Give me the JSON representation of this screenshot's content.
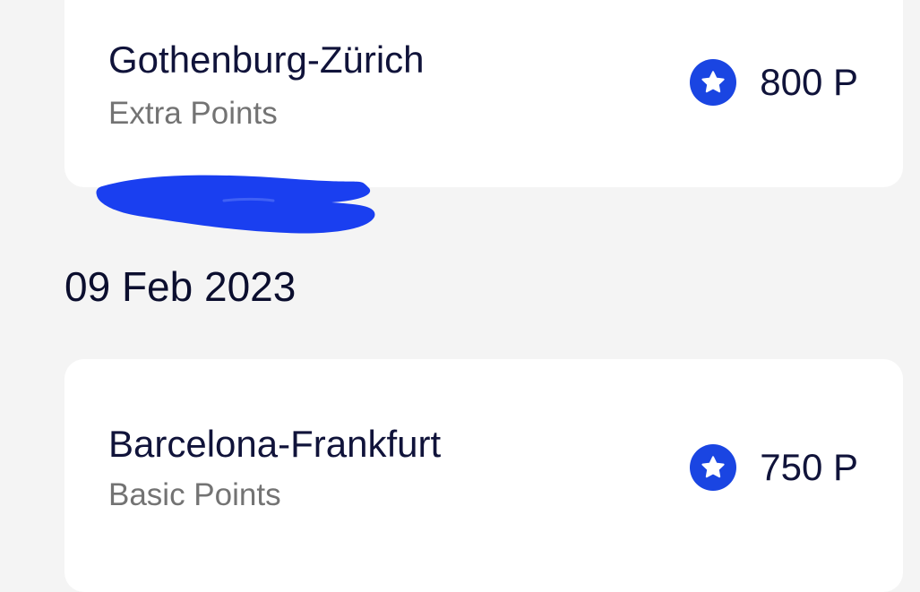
{
  "colors": {
    "background": "#f4f4f4",
    "card": "#ffffff",
    "accent": "#1a45e2",
    "primary_text": "#10133a",
    "secondary_text": "#737373",
    "redaction": "#1a3ff0"
  },
  "transactions": [
    {
      "route": "Gothenburg-Zürich",
      "type": "Extra Points",
      "points": "800 P",
      "icon": "star-icon"
    },
    {
      "route": "Barcelona-Frankfurt",
      "type": "Basic Points",
      "points": "750 P",
      "icon": "star-icon"
    }
  ],
  "date_group": {
    "label": "09 Feb 2023"
  }
}
